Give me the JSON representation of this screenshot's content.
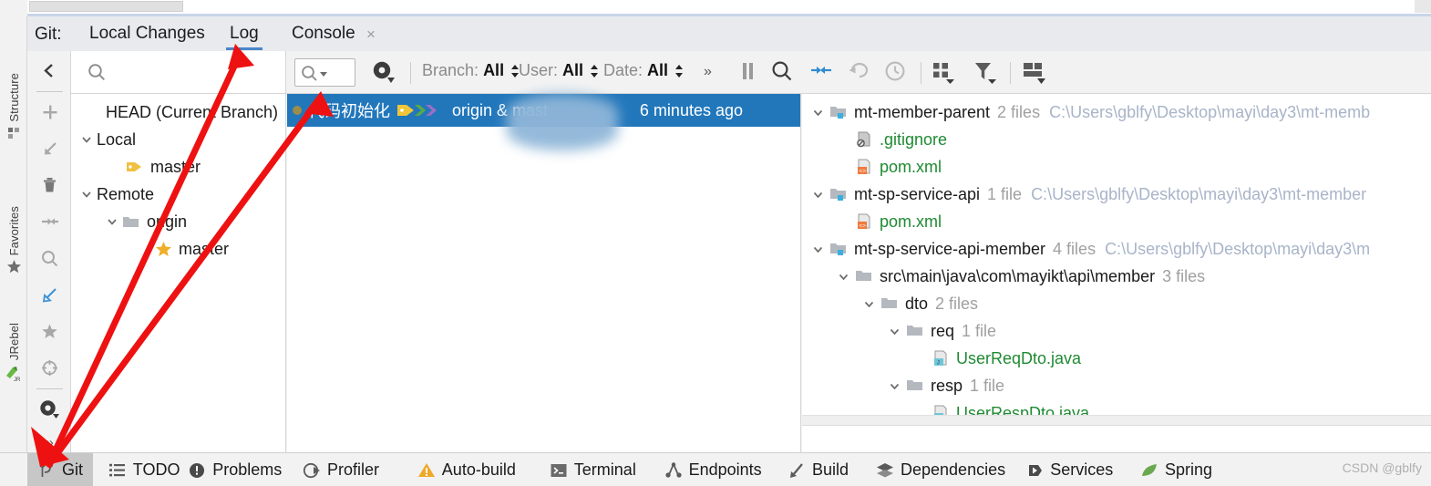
{
  "window": {
    "tool_label": "Git:",
    "tabs": [
      {
        "label": "Local Changes",
        "active": false,
        "closable": false
      },
      {
        "label": "Log",
        "active": true,
        "closable": false
      },
      {
        "label": "Console",
        "active": false,
        "closable": true,
        "close_glyph": "×"
      }
    ]
  },
  "left_strip": {
    "items": [
      {
        "label": "Structure",
        "icon": "structure-icon"
      },
      {
        "label": "Favorites",
        "icon": "star-icon"
      },
      {
        "label": "JRebel",
        "icon": "jrebel-icon"
      }
    ]
  },
  "icon_rail": {
    "items": [
      {
        "icon": "collapse-left-icon",
        "name": "hide-panel"
      },
      {
        "icon": "plus-icon",
        "name": "new-branch"
      },
      {
        "icon": "checkout-icon",
        "name": "checkout"
      },
      {
        "icon": "trash-icon",
        "name": "delete-branch"
      },
      {
        "icon": "merge-icon",
        "name": "merge"
      },
      {
        "icon": "search-icon",
        "name": "search-branch"
      },
      {
        "icon": "edit-blue-icon",
        "name": "edit"
      },
      {
        "icon": "star-icon",
        "name": "favorite"
      },
      {
        "icon": "target-icon",
        "name": "show-current"
      },
      {
        "icon": "gear-icon",
        "name": "settings"
      },
      {
        "icon": "chevrons-icon",
        "name": "more"
      }
    ]
  },
  "toolbar": {
    "branch_search_placeholder": "",
    "filter_input_value": "",
    "filters": [
      {
        "key": "Branch:",
        "value": "All"
      },
      {
        "key": "User:",
        "value": "All"
      },
      {
        "key": "Date:",
        "value": "All"
      }
    ],
    "overflow_glyph": "»",
    "icons": [
      {
        "name": "pause-icon"
      },
      {
        "name": "search-icon"
      },
      {
        "name": "collapse-all-icon"
      },
      {
        "name": "revert-icon"
      },
      {
        "name": "history-icon"
      },
      {
        "name": "grid-view-icon"
      },
      {
        "name": "filter-icon"
      },
      {
        "name": "layout-icon"
      }
    ]
  },
  "branches": {
    "rows": [
      {
        "label": "HEAD (Current Branch)",
        "indent": 0,
        "twisty": "none",
        "icon": "none"
      },
      {
        "label": "Local",
        "indent": 0,
        "twisty": "expanded",
        "icon": "none"
      },
      {
        "label": "master",
        "indent": 1,
        "twisty": "none",
        "icon": "tag-icon"
      },
      {
        "label": "Remote",
        "indent": 0,
        "twisty": "expanded",
        "icon": "none"
      },
      {
        "label": "origin",
        "indent": 1,
        "twisty": "expanded",
        "icon": "folder-icon"
      },
      {
        "label": "master",
        "indent": 2,
        "twisty": "none",
        "icon": "star-icon"
      }
    ]
  },
  "commits": {
    "selected_row": {
      "message": "代码初始化",
      "refs": "origin & mast",
      "time": "6 minutes ago",
      "labels": [
        {
          "name": "tag-yellow-icon",
          "color": "#f0c538"
        },
        {
          "name": "chevron-green-icon",
          "color": "#5aab46"
        },
        {
          "name": "chevron-purple-icon",
          "color": "#9a6fc4"
        }
      ]
    }
  },
  "files": {
    "rows": [
      {
        "indent": 0,
        "twisty": "expanded",
        "icon": "module-folder-icon",
        "name": "mt-member-parent",
        "kind": "dir",
        "meta": "2 files",
        "path": "C:\\Users\\gblfy\\Desktop\\mayi\\day3\\mt-memb"
      },
      {
        "indent": 1,
        "twisty": "none",
        "icon": "gitignore-file-icon",
        "name": ".gitignore",
        "kind": "file",
        "meta": "",
        "path": ""
      },
      {
        "indent": 1,
        "twisty": "none",
        "icon": "xml-file-icon",
        "name": "pom.xml",
        "kind": "file",
        "meta": "",
        "path": ""
      },
      {
        "indent": 0,
        "twisty": "expanded",
        "icon": "module-folder-icon",
        "name": "mt-sp-service-api",
        "kind": "dir",
        "meta": "1 file",
        "path": "C:\\Users\\gblfy\\Desktop\\mayi\\day3\\mt-member"
      },
      {
        "indent": 1,
        "twisty": "none",
        "icon": "xml-file-icon",
        "name": "pom.xml",
        "kind": "file",
        "meta": "",
        "path": ""
      },
      {
        "indent": 0,
        "twisty": "expanded",
        "icon": "module-folder-icon",
        "name": "mt-sp-service-api-member",
        "kind": "dir",
        "meta": "4 files",
        "path": "C:\\Users\\gblfy\\Desktop\\mayi\\day3\\m"
      },
      {
        "indent": 1,
        "twisty": "expanded",
        "icon": "folder-icon",
        "name": "src\\main\\java\\com\\mayikt\\api\\member",
        "kind": "dir",
        "meta": "3 files",
        "path": ""
      },
      {
        "indent": 2,
        "twisty": "expanded",
        "icon": "folder-icon",
        "name": "dto",
        "kind": "dir",
        "meta": "2 files",
        "path": ""
      },
      {
        "indent": 3,
        "twisty": "expanded",
        "icon": "folder-icon",
        "name": "req",
        "kind": "dir",
        "meta": "1 file",
        "path": ""
      },
      {
        "indent": 4,
        "twisty": "none",
        "icon": "java-file-icon",
        "name": "UserReqDto.java",
        "kind": "file",
        "meta": "",
        "path": ""
      },
      {
        "indent": 3,
        "twisty": "expanded",
        "icon": "folder-icon",
        "name": "resp",
        "kind": "dir",
        "meta": "1 file",
        "path": ""
      },
      {
        "indent": 4,
        "twisty": "none",
        "icon": "java-file-icon",
        "name": "UserRespDto.java",
        "kind": "file",
        "meta": "",
        "path": ""
      }
    ]
  },
  "statusbar": {
    "buttons": [
      {
        "label": "Git",
        "icon": "git-branch-icon",
        "selected": true
      },
      {
        "label": "TODO",
        "icon": "todo-list-icon",
        "selected": false
      },
      {
        "label": "Problems",
        "icon": "problems-icon",
        "selected": false
      },
      {
        "label": "Profiler",
        "icon": "profiler-icon",
        "selected": false
      },
      {
        "label": "Auto-build",
        "icon": "warning-triangle-icon",
        "selected": false
      },
      {
        "label": "Terminal",
        "icon": "terminal-icon",
        "selected": false
      },
      {
        "label": "Endpoints",
        "icon": "endpoints-icon",
        "selected": false
      },
      {
        "label": "Build",
        "icon": "hammer-icon",
        "selected": false
      },
      {
        "label": "Dependencies",
        "icon": "layers-icon",
        "selected": false
      },
      {
        "label": "Services",
        "icon": "services-play-icon",
        "selected": false
      },
      {
        "label": "Spring",
        "icon": "spring-leaf-icon",
        "selected": false
      }
    ],
    "watermark": "CSDN @gblfy"
  },
  "colors": {
    "selection_blue": "#2277bb",
    "tab_underline": "#4a86c8",
    "file_green": "#1f8a32",
    "path_grey": "#a8b4c8",
    "annotation_red": "#ee1111"
  }
}
